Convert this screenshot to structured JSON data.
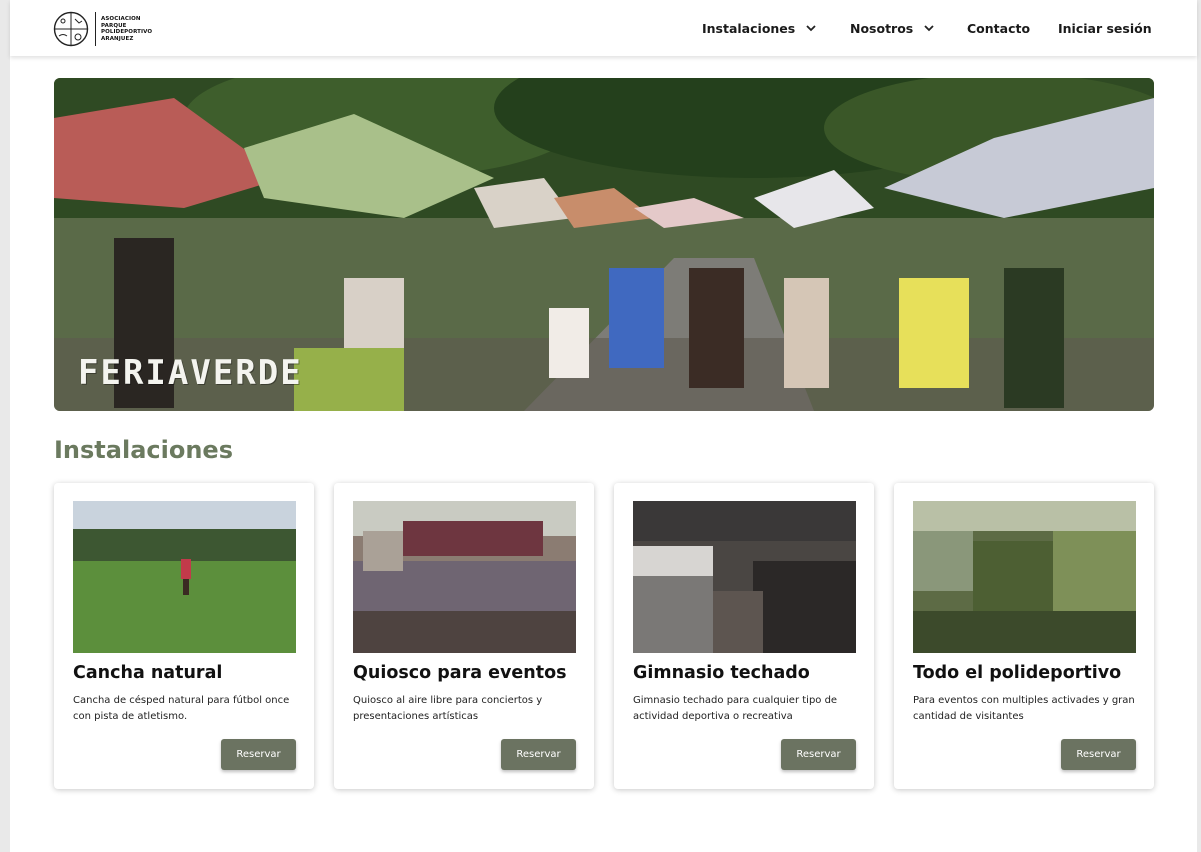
{
  "brand": {
    "logo_text": [
      "ASOCIACION",
      "PARQUE",
      "POLIDEPORTIVO",
      "ARANJUEZ"
    ]
  },
  "nav": {
    "instalaciones": "Instalaciones",
    "nosotros": "Nosotros",
    "contacto": "Contacto",
    "login": "Iniciar sesión"
  },
  "hero": {
    "overlay_text": "FERIAVERDE"
  },
  "section": {
    "title": "Instalaciones"
  },
  "cards": [
    {
      "title": "Cancha natural",
      "description": "Cancha de césped natural para fútbol once con pista de atletismo.",
      "button": "Reservar"
    },
    {
      "title": "Quiosco para eventos",
      "description": "Quiosco al aire libre para conciertos y presentaciones artísticas",
      "button": "Reservar"
    },
    {
      "title": "Gimnasio techado",
      "description": "Gimnasio techado para cualquier tipo de actividad deportiva o recreativa",
      "button": "Reservar"
    },
    {
      "title": "Todo el polideportivo",
      "description": "Para eventos con multiples activades y gran cantidad de visitantes",
      "button": "Reservar"
    }
  ],
  "colors": {
    "accent": "#6b7a5f",
    "button": "#6b7361"
  },
  "icons": {
    "logo": "sports-circle-logo-icon",
    "dropdown": "chevron-down-icon"
  }
}
